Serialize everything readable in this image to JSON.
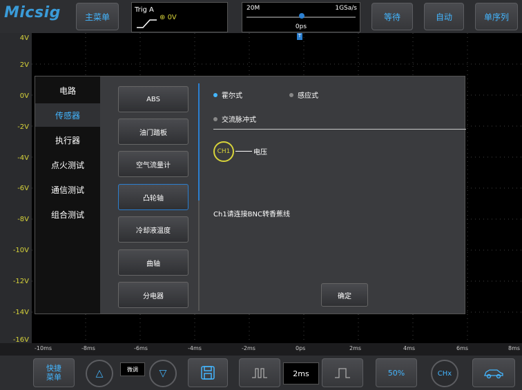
{
  "header": {
    "logo": "Micsig",
    "main_menu": "主菜单",
    "trigger": {
      "label": "Trig A",
      "level": "0V"
    },
    "timebase": {
      "memory": "20M",
      "sample_rate": "1GSa/s",
      "offset": "0ps"
    },
    "wait_button": "等待",
    "auto_button": "自动",
    "single_button": "单序列"
  },
  "y_axis": [
    "4V",
    "2V",
    "0V",
    "-2V",
    "-4V",
    "-6V",
    "-8V",
    "-10V",
    "-12V",
    "-14V",
    "-16V"
  ],
  "x_axis": [
    "-10ms",
    "-8ms",
    "-6ms",
    "-4ms",
    "-2ms",
    "0ps",
    "2ms",
    "4ms",
    "6ms",
    "8ms"
  ],
  "dialog": {
    "categories": [
      "电路",
      "传感器",
      "执行器",
      "点火测试",
      "通信测试",
      "组合测试"
    ],
    "active_category": "传感器",
    "sensors": [
      "ABS",
      "油门踏板",
      "空气流量计",
      "凸轮轴",
      "冷却液温度",
      "曲轴",
      "分电器"
    ],
    "active_sensor": "凸轮轴",
    "options": {
      "hall": "霍尔式",
      "inductive": "感应式",
      "ac_pulse": "交流脉冲式"
    },
    "channel": "CH1",
    "channel_text": "电压",
    "hint": "Ch1请连接BNC转香蕉线",
    "ok": "确定"
  },
  "footer": {
    "quick_menu_line1": "快捷",
    "quick_menu_line2": "菜单",
    "fine_label": "微调",
    "timebase_value": "2ms",
    "percent": "50%",
    "ch_button": "CHx"
  },
  "colors": {
    "accent": "#44b6ff",
    "channel1": "#d8d43a"
  }
}
